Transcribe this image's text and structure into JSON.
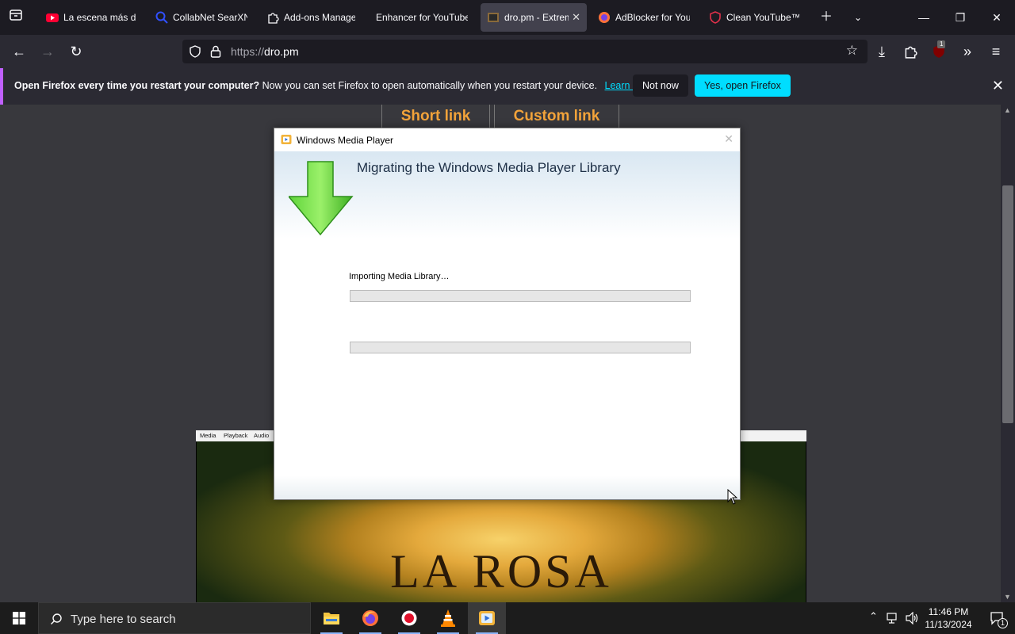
{
  "browser": {
    "tabs": [
      {
        "title": "La escena más dr",
        "icon": "youtube-icon",
        "active": false
      },
      {
        "title": "CollabNet SearXN",
        "icon": "search-icon",
        "active": false
      },
      {
        "title": "Add-ons Manage",
        "icon": "puzzle-icon",
        "active": false
      },
      {
        "title": "Enhancer for YouTube",
        "icon": "none",
        "active": false
      },
      {
        "title": "dro.pm - Extrem",
        "icon": "dro-icon",
        "active": true
      },
      {
        "title": "AdBlocker for You",
        "icon": "firefox-icon",
        "active": false
      },
      {
        "title": "Clean YouTube™",
        "icon": "shield-icon",
        "active": false
      }
    ],
    "url_scheme": "https://",
    "url_host": "dro.pm",
    "extension_badge": "1"
  },
  "notification": {
    "bold": "Open Firefox every time you restart your computer?",
    "text": "Now you can set Firefox to open automatically when you restart your device.",
    "learn_more": "Learn more",
    "not_now": "Not now",
    "yes_open": "Yes, open Firefox"
  },
  "site": {
    "short_link": "Short link",
    "custom_link": "Custom link",
    "player_menu": [
      "Media",
      "Playback",
      "Audio"
    ],
    "video_title": "LA ROSA"
  },
  "wmp_dialog": {
    "title": "Windows Media Player",
    "heading": "Migrating the Windows Media Player Library",
    "status": "Importing Media Library…",
    "progress1": 0,
    "progress2": 0
  },
  "taskbar": {
    "search_placeholder": "Type here to search",
    "time": "11:46 PM",
    "date": "11/13/2024",
    "notification_count": "1"
  },
  "colors": {
    "accent_cyan": "#00ddff",
    "site_orange": "#f2a33a",
    "progress_green": "#06b025"
  }
}
